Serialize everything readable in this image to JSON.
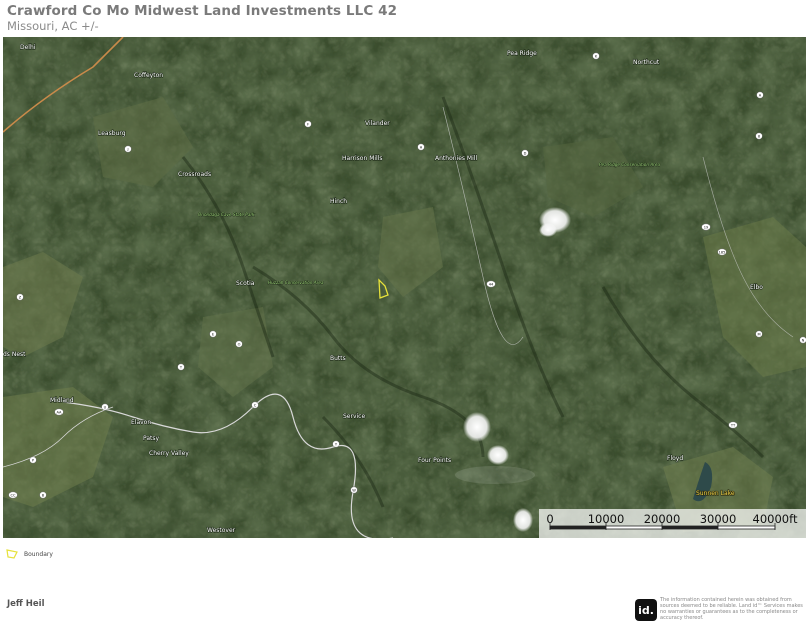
{
  "header": {
    "title": "Crawford Co Mo Midwest Land Investments LLC 42",
    "subtitle": "Missouri,  AC +/-"
  },
  "map": {
    "basemap": "satellite imagery",
    "boundary_color": "#e6e13a",
    "places": [
      {
        "id": "delhi",
        "label": "Delhi",
        "style": "white"
      },
      {
        "id": "coffeyton",
        "label": "Coffeyton",
        "style": "white"
      },
      {
        "id": "pea-ridge",
        "label": "Pea Ridge",
        "style": "white"
      },
      {
        "id": "northcut",
        "label": "Northcut",
        "style": "white"
      },
      {
        "id": "leasburg",
        "label": "Leasburg",
        "style": "white"
      },
      {
        "id": "vilander",
        "label": "Vilander",
        "style": "white"
      },
      {
        "id": "harrison-mills",
        "label": "Harrison Mills",
        "style": "white"
      },
      {
        "id": "anthonies-mill",
        "label": "Anthonies Mill",
        "style": "white"
      },
      {
        "id": "crossroads",
        "label": "Crossroads",
        "style": "white"
      },
      {
        "id": "hinch",
        "label": "Hinch",
        "style": "white"
      },
      {
        "id": "scotia",
        "label": "Scotia",
        "style": "white"
      },
      {
        "id": "butts",
        "label": "Butts",
        "style": "white"
      },
      {
        "id": "service",
        "label": "Service",
        "style": "white"
      },
      {
        "id": "midland",
        "label": "Midland",
        "style": "white"
      },
      {
        "id": "elavon",
        "label": "Elavon",
        "style": "white"
      },
      {
        "id": "patsy",
        "label": "Patsy",
        "style": "white"
      },
      {
        "id": "cherry-valley",
        "label": "Cherry Valley",
        "style": "white"
      },
      {
        "id": "four-points",
        "label": "Four Points",
        "style": "white"
      },
      {
        "id": "floyd",
        "label": "Floyd",
        "style": "white"
      },
      {
        "id": "westover",
        "label": "Westover",
        "style": "white"
      },
      {
        "id": "elbo",
        "label": "Elbo",
        "style": "white"
      },
      {
        "id": "ds-nest",
        "label": "ds Nest",
        "style": "white"
      },
      {
        "id": "sunnen-lake",
        "label": "Sunnen Lake",
        "style": "yellow"
      },
      {
        "id": "pea-ridge-ca",
        "label": "Pea Ridge Conservation Area",
        "style": "green"
      },
      {
        "id": "huzzah-ca",
        "label": "Huzzah Conservation Area",
        "style": "green"
      },
      {
        "id": "onondaga",
        "label": "Onondaga Cave State Park",
        "style": "green"
      }
    ],
    "shields": [
      "F",
      "H",
      "D",
      "K",
      "A",
      "8",
      "19",
      "185",
      "M",
      "N",
      "T",
      "C",
      "Y",
      "W",
      "E",
      "O",
      "J",
      "Z",
      "AA",
      "U",
      "P",
      "B",
      "CC",
      "TT",
      "44"
    ]
  },
  "scale_bar": {
    "labels": [
      "0",
      "10000",
      "20000",
      "30000",
      "40000ft"
    ]
  },
  "legend": {
    "items": [
      {
        "label": "Boundary",
        "color": "#e6e13a"
      }
    ]
  },
  "footer": {
    "author": "Jeff Heil",
    "logo_text": "id.",
    "disclaimer": "The information contained herein was obtained from sources deemed to be reliable. Land id™ Services makes no warranties or guarantees as to the completeness or accuracy thereof."
  }
}
